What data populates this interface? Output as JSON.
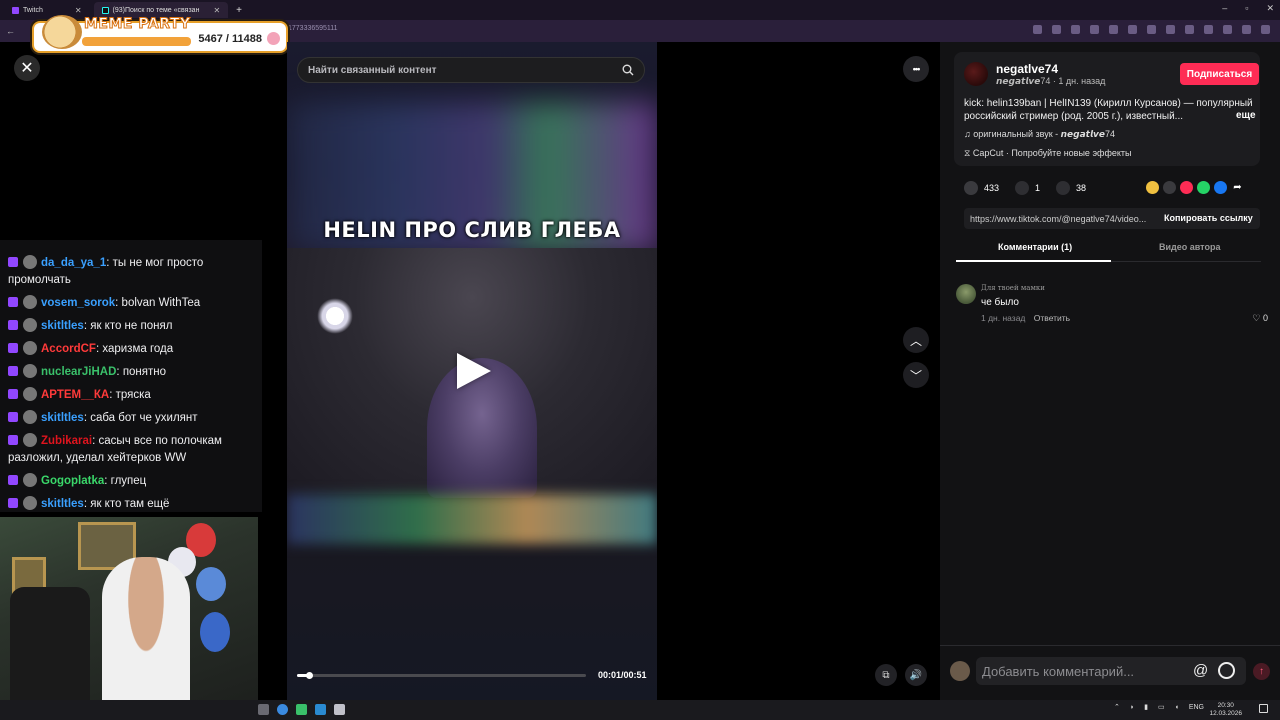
{
  "browser": {
    "tabs": [
      {
        "label": "Twitch"
      },
      {
        "label": "(93)Поиск по теме «связан"
      }
    ],
    "url": "1773336595111"
  },
  "overlay": {
    "title": "MEME PARTY",
    "progress": "5467 / 11488",
    "progress_fraction": 0.476
  },
  "stream": {
    "close_glyph": "✕",
    "chat": [
      {
        "user": "da_da_ya_1",
        "color": "#3aa0ff",
        "text": "ты не мог просто промолчать"
      },
      {
        "user": "vosem_sorok",
        "color": "#3aa0ff",
        "text": "bolvan WithTea"
      },
      {
        "user": "skitltles",
        "color": "#3aa0ff",
        "text": "як кто не понял"
      },
      {
        "user": "AccordCF",
        "color": "#ff3a3a",
        "text": "харизма года"
      },
      {
        "user": "nuclearJiHAD",
        "color": "#3ac06a",
        "text": "понятно"
      },
      {
        "user": "АРТЕМ__КА",
        "color": "#ff3a3a",
        "text": "тряска"
      },
      {
        "user": "skitltles",
        "color": "#3aa0ff",
        "text": "саба бот че ухилянт"
      },
      {
        "user": "Zubikarai",
        "color": "#e0141e",
        "text": "сасыч все по полочкам разложил, уделал хейтерков WW"
      },
      {
        "user": "Gogoplatka",
        "color": "#3ad86a",
        "text": "глупец"
      },
      {
        "user": "skitltles",
        "color": "#3aa0ff",
        "text": "як кто там ещё"
      }
    ]
  },
  "tiktok": {
    "search_placeholder": "Найти связанный контент",
    "video_caption": "HELIN ПРО СЛИВ ГЛЕБА",
    "timecode": "00:01/00:51",
    "progress_fraction": 0.04,
    "more_glyph": "•••",
    "up_glyph": "︿",
    "down_glyph": "﹀",
    "author": {
      "name": "negatlve74",
      "sub": "𝙣𝙚𝙜𝙖𝙩𝙡𝙫𝙚74 · 1 дн. назад",
      "follow_label": "Подписаться"
    },
    "description": "kick: helin139ban | HelIN139 (Кирилл Курсанов) — популярный российский стример (род. 2005 г.), известный...",
    "description_more": "еще",
    "sound": "♫  оригинальный звук - 𝙣𝙚𝙜𝙖𝙩𝙡𝙫𝙚74",
    "capcut": "CapCut · Попробуйте новые эффекты",
    "stats": {
      "likes": "433",
      "comments": "1",
      "saves": "38"
    },
    "share_link": "https://www.tiktok.com/@negatlve74/video...",
    "copy_link_label": "Копировать ссылку",
    "tabs": {
      "comments": "Комментарии (1)",
      "author_videos": "Видео автора"
    },
    "comment": {
      "user": "Для твоей мамки",
      "text": "че было",
      "time": "1 дн. назад",
      "reply": "Ответить",
      "likes": "0"
    },
    "comment_input_placeholder": "Добавить комментарий...",
    "at_glyph": "@",
    "send_glyph": "↑"
  },
  "taskbar": {
    "lang": "ENG",
    "time": "20:30",
    "date": "12.03.2026"
  }
}
